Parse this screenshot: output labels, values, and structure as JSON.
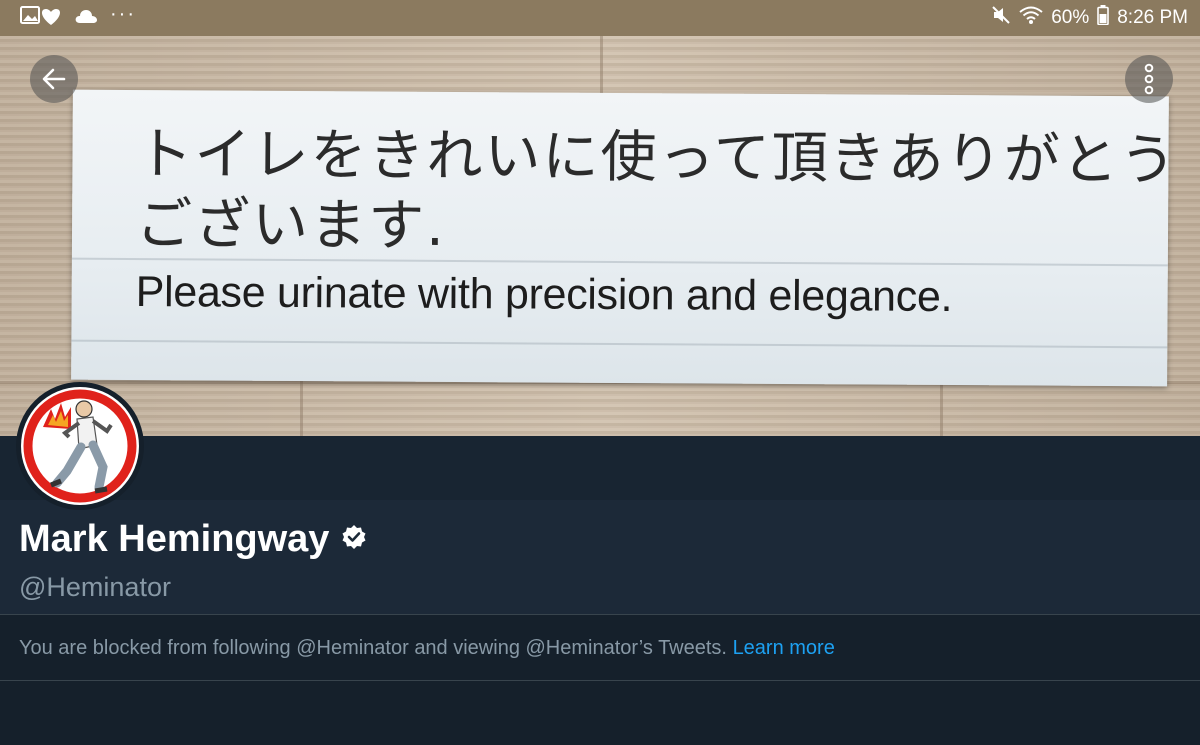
{
  "status_bar": {
    "dots": "···",
    "battery": "60%",
    "time": "8:26 PM"
  },
  "header_photo": {
    "sign_text_jp_line1": "トイレをきれいに使って頂きありがとう",
    "sign_text_jp_line2": "ございます.",
    "sign_text_en": "Please urinate with precision and elegance."
  },
  "profile": {
    "name": "Mark Hemingway",
    "handle": "@Heminator",
    "verified": true,
    "blocked_message": "You are blocked from following @Heminator and viewing @Heminator’s Tweets.",
    "learn_more": "Learn more"
  },
  "icons": {
    "back": "arrow-left-icon",
    "more": "more-vertical-icon",
    "verified": "verified-badge-icon"
  },
  "colors": {
    "background": "#15202b",
    "accent": "#1da1f2",
    "secondary_text": "#8899a6",
    "status_bar": "#8b7a5f"
  }
}
